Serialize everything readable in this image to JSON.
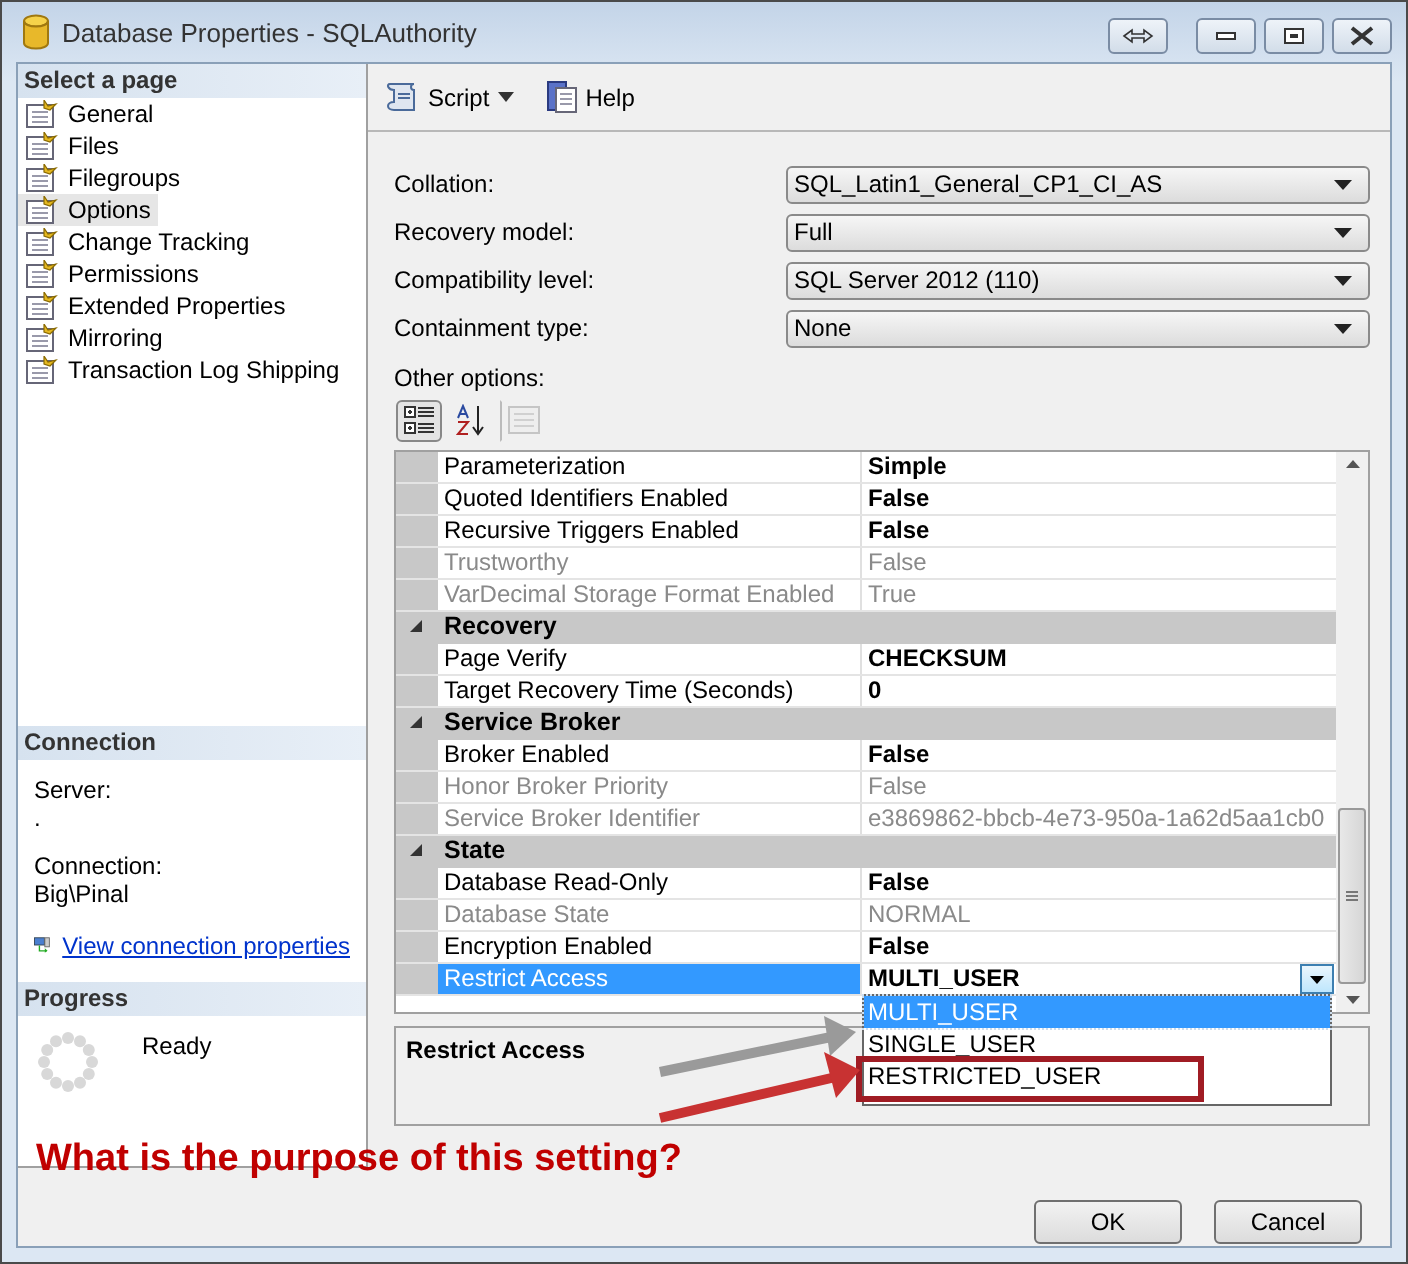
{
  "window": {
    "title": "Database Properties - SQLAuthority"
  },
  "sidebar": {
    "header": "Select a page",
    "items": [
      {
        "label": "General",
        "selected": false
      },
      {
        "label": "Files",
        "selected": false
      },
      {
        "label": "Filegroups",
        "selected": false
      },
      {
        "label": "Options",
        "selected": true
      },
      {
        "label": "Change Tracking",
        "selected": false
      },
      {
        "label": "Permissions",
        "selected": false
      },
      {
        "label": "Extended Properties",
        "selected": false
      },
      {
        "label": "Mirroring",
        "selected": false
      },
      {
        "label": "Transaction Log Shipping",
        "selected": false
      }
    ]
  },
  "connection": {
    "header": "Connection",
    "server_label": "Server:",
    "server_value": ".",
    "connection_label": "Connection:",
    "connection_value": "Big\\Pinal",
    "link": "View connection properties"
  },
  "progress": {
    "header": "Progress",
    "status": "Ready"
  },
  "toolbar": {
    "script": "Script",
    "help": "Help"
  },
  "fields": [
    {
      "label": "Collation:",
      "value": "SQL_Latin1_General_CP1_CI_AS"
    },
    {
      "label": "Recovery model:",
      "value": "Full"
    },
    {
      "label": "Compatibility level:",
      "value": "SQL Server 2012 (110)"
    },
    {
      "label": "Containment type:",
      "value": "None"
    }
  ],
  "other_options_label": "Other options:",
  "grid": {
    "toolbar_buttons": [
      {
        "kind": "categorized",
        "selected": true,
        "disabled": false
      },
      {
        "kind": "alphabetical",
        "selected": false,
        "disabled": false
      },
      {
        "kind": "pages",
        "selected": false,
        "disabled": true
      }
    ],
    "rows": [
      {
        "kind": "property",
        "name": "Parameterization",
        "value": "Simple",
        "disabled": false,
        "selected": false
      },
      {
        "kind": "property",
        "name": "Quoted Identifiers Enabled",
        "value": "False",
        "disabled": false,
        "selected": false
      },
      {
        "kind": "property",
        "name": "Recursive Triggers Enabled",
        "value": "False",
        "disabled": false,
        "selected": false
      },
      {
        "kind": "property",
        "name": "Trustworthy",
        "value": "False",
        "disabled": true,
        "selected": false
      },
      {
        "kind": "property",
        "name": "VarDecimal Storage Format Enabled",
        "value": "True",
        "disabled": true,
        "selected": false
      },
      {
        "kind": "category",
        "name": "Recovery",
        "expanded": true
      },
      {
        "kind": "property",
        "name": "Page Verify",
        "value": "CHECKSUM",
        "disabled": false,
        "selected": false
      },
      {
        "kind": "property",
        "name": "Target Recovery Time (Seconds)",
        "value": "0",
        "disabled": false,
        "selected": false
      },
      {
        "kind": "category",
        "name": "Service Broker",
        "expanded": true
      },
      {
        "kind": "property",
        "name": "Broker Enabled",
        "value": "False",
        "disabled": false,
        "selected": false
      },
      {
        "kind": "property",
        "name": "Honor Broker Priority",
        "value": "False",
        "disabled": true,
        "selected": false
      },
      {
        "kind": "property",
        "name": "Service Broker Identifier",
        "value": "e3869862-bbcb-4e73-950a-1a62d5aa1cb0",
        "disabled": true,
        "selected": false
      },
      {
        "kind": "category",
        "name": "State",
        "expanded": true
      },
      {
        "kind": "property",
        "name": "Database Read-Only",
        "value": "False",
        "disabled": false,
        "selected": false
      },
      {
        "kind": "property",
        "name": "Database State",
        "value": "NORMAL",
        "disabled": true,
        "selected": false
      },
      {
        "kind": "property",
        "name": "Encryption Enabled",
        "value": "False",
        "disabled": false,
        "selected": false
      },
      {
        "kind": "property",
        "name": "Restrict Access",
        "value": "MULTI_USER",
        "disabled": false,
        "selected": true
      }
    ],
    "dropdown": {
      "options": [
        {
          "label": "MULTI_USER",
          "selected": true,
          "annotated": false
        },
        {
          "label": "SINGLE_USER",
          "selected": false,
          "annotated": false
        },
        {
          "label": "RESTRICTED_USER",
          "selected": false,
          "annotated": true
        }
      ]
    },
    "description_title": "Restrict Access"
  },
  "annotation": "What is the purpose of this setting?",
  "buttons": [
    "OK",
    "Cancel"
  ]
}
